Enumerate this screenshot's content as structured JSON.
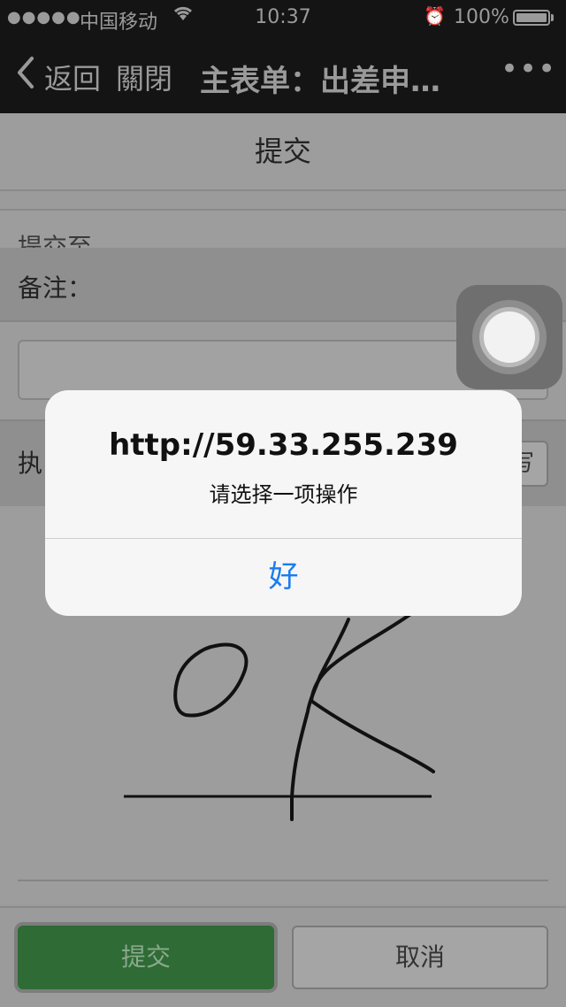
{
  "status_bar": {
    "signal": "●●●●●",
    "carrier": "中国移动",
    "wifi_icon": "wifi-icon",
    "time": "10:37",
    "alarm_icon": "alarm-icon",
    "battery_text": "100%"
  },
  "nav_bar": {
    "back_label": "返回",
    "close_label": "關閉",
    "title": "主表单：出差申…",
    "more_label": "•••"
  },
  "page": {
    "header_title": "提交",
    "submit_to_label": "提交至",
    "remark_label": "备注：",
    "remark_value": "",
    "exec_label": "执",
    "sign_button_label": "写",
    "submit_button": "提交",
    "cancel_button": "取消"
  },
  "alert": {
    "title": "http://59.33.255.239",
    "message": "请选择一项操作",
    "ok_button": "好"
  },
  "colors": {
    "alert_button_blue": "#1a7cf2",
    "submit_green": "#2f6b35",
    "navbar_dark": "#141414"
  }
}
